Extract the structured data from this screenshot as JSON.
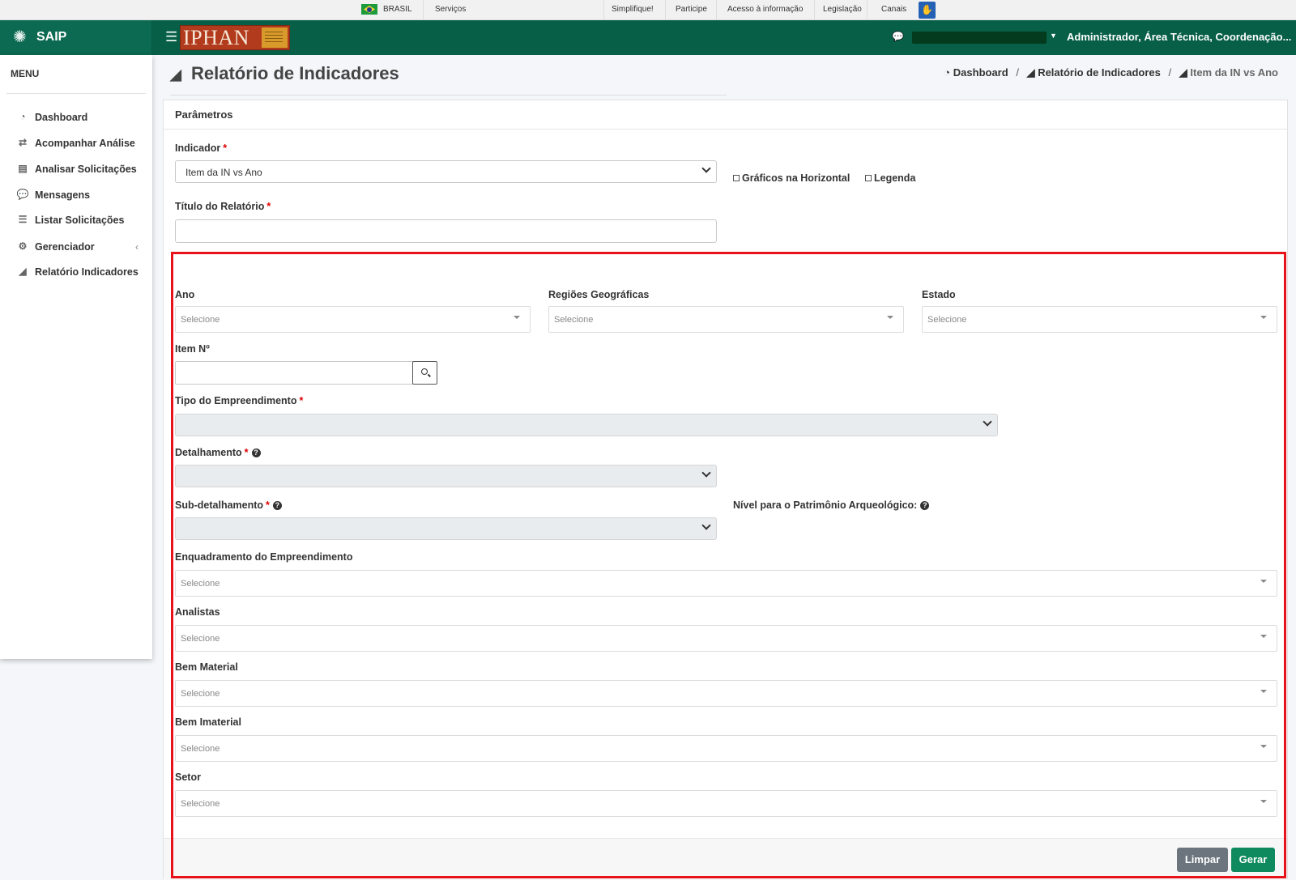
{
  "govbar": {
    "brasil": "BRASIL",
    "servicos": "Serviços",
    "links": [
      "Simplifique!",
      "Participe",
      "Acesso à informação",
      "Legislação",
      "Canais"
    ]
  },
  "header": {
    "app_name": "SAIP",
    "logo_text": "IPHAN",
    "user_role": "Administrador, Área Técnica, Coordenação..."
  },
  "sidebar": {
    "title": "MENU",
    "items": [
      {
        "label": "Dashboard",
        "icon": "dashboard-icon"
      },
      {
        "label": "Acompanhar Análise",
        "icon": "exchange-icon"
      },
      {
        "label": "Analisar Solicitações",
        "icon": "book-icon"
      },
      {
        "label": "Mensagens",
        "icon": "comments-icon"
      },
      {
        "label": "Listar Solicitações",
        "icon": "list-icon"
      },
      {
        "label": "Gerenciador",
        "icon": "gears-icon"
      },
      {
        "label": "Relatório Indicadores",
        "icon": "area-chart-icon"
      }
    ]
  },
  "page": {
    "title": "Relatório de Indicadores",
    "breadcrumb": [
      "Dashboard",
      "Relatório de Indicadores",
      "Item da IN vs Ano"
    ]
  },
  "form": {
    "card_title": "Parâmetros",
    "indicador_label": "Indicador",
    "indicador_value": "Item da IN vs Ano",
    "chk_horizontal": "Gráficos na Horizontal",
    "chk_legenda": "Legenda",
    "titulo_label": "Título do Relatório",
    "titulo_value": "",
    "ano_label": "Ano",
    "regioes_label": "Regiões Geográficas",
    "estado_label": "Estado",
    "placeholder": "Selecione",
    "item_label": "Item Nº",
    "tipo_label": "Tipo do Empreendimento",
    "detalhamento_label": "Detalhamento",
    "subdetalhamento_label": "Sub-detalhamento",
    "nivel_label": "Nível para o Patrimônio Arqueológico:",
    "enquadramento_label": "Enquadramento do Empreendimento",
    "analistas_label": "Analistas",
    "bem_material_label": "Bem Material",
    "bem_imaterial_label": "Bem Imaterial",
    "setor_label": "Setor",
    "btn_limpar": "Limpar",
    "btn_gerar": "Gerar"
  },
  "colors": {
    "header_bg": "#075f47",
    "highlight_border": "#e8121b",
    "btn_gerar": "#0f8a5f",
    "btn_limpar": "#6c757d"
  }
}
